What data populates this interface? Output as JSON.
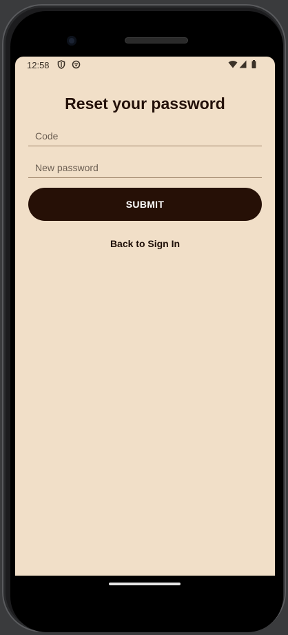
{
  "status_bar": {
    "time": "12:58",
    "icons": [
      "shield-icon",
      "sync-icon",
      "wifi-icon",
      "signal-icon",
      "battery-icon"
    ]
  },
  "page": {
    "title": "Reset your password"
  },
  "form": {
    "code_placeholder": "Code",
    "code_value": "",
    "new_password_placeholder": "New password",
    "new_password_value": "",
    "submit_label": "SUBMIT"
  },
  "links": {
    "back_to_sign_in": "Back to Sign In"
  },
  "colors": {
    "background": "#f1dfc8",
    "button": "#261006",
    "text": "#24110a"
  }
}
